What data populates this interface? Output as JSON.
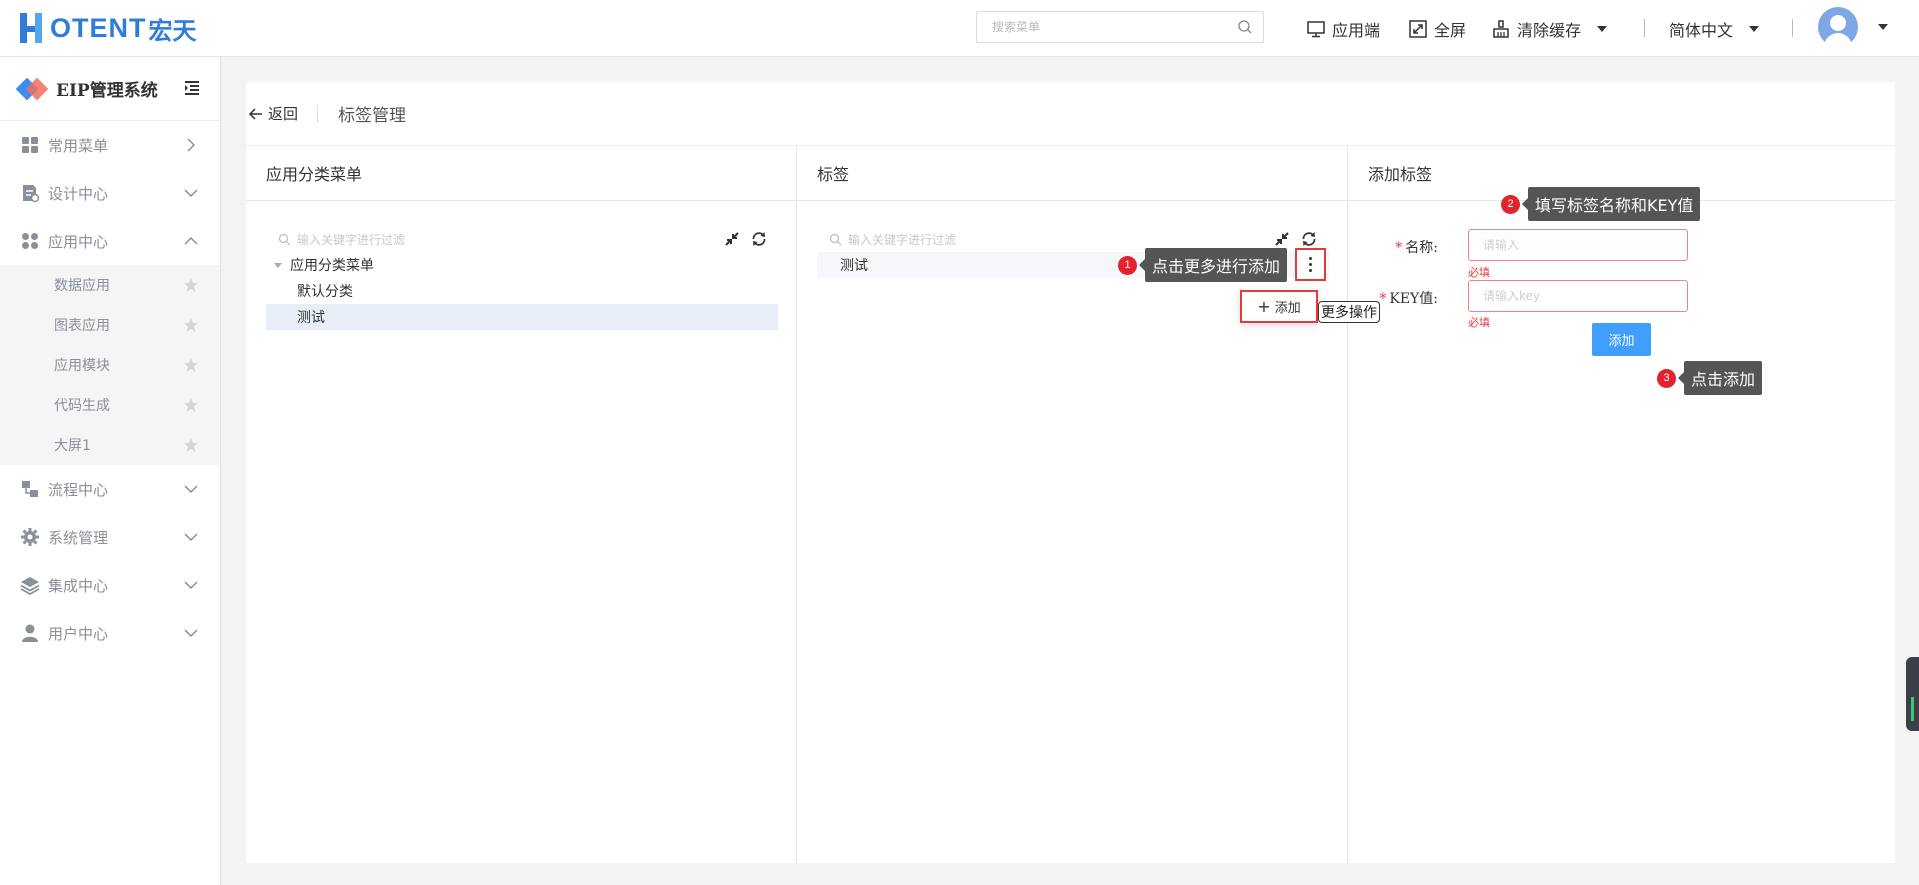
{
  "header": {
    "logo_text": "OTENT",
    "logo_cn": "宏天",
    "search_placeholder": "搜索菜单",
    "nav": {
      "app_end": "应用端",
      "fullscreen": "全屏",
      "clear_cache": "清除缓存",
      "language": "简体中文"
    }
  },
  "sidebar": {
    "system_name": "EIP管理系统",
    "menus": [
      {
        "label": "常用菜单",
        "icon": "grid-icon",
        "state": "collapsed-right"
      },
      {
        "label": "设计中心",
        "icon": "design-doc-icon",
        "state": "collapsed"
      },
      {
        "label": "应用中心",
        "icon": "apps-icon",
        "state": "expanded"
      },
      {
        "label": "流程中心",
        "icon": "flow-icon",
        "state": "collapsed"
      },
      {
        "label": "系统管理",
        "icon": "gear-icon",
        "state": "collapsed"
      },
      {
        "label": "集成中心",
        "icon": "layers-icon",
        "state": "collapsed"
      },
      {
        "label": "用户中心",
        "icon": "user-icon",
        "state": "collapsed"
      }
    ],
    "app_center_items": [
      "数据应用",
      "图表应用",
      "应用模块",
      "代码生成",
      "大屏1"
    ]
  },
  "page": {
    "back_label": "返回",
    "title": "标签管理"
  },
  "category_panel": {
    "title": "应用分类菜单",
    "filter_placeholder": "输入关键字进行过滤",
    "tree": {
      "root": "应用分类菜单",
      "children": [
        "默认分类",
        "测试"
      ],
      "selected": "测试"
    }
  },
  "tag_panel": {
    "title": "标签",
    "filter_placeholder": "输入关键字进行过滤",
    "row_label": "测试",
    "dropdown_add": "添加",
    "more_tooltip": "更多操作"
  },
  "add_panel": {
    "title": "添加标签",
    "name_label": "名称:",
    "name_placeholder": "请输入",
    "key_label": "KEY值:",
    "key_placeholder": "请输入key",
    "required_msg": "必填",
    "submit_label": "添加"
  },
  "callouts": [
    {
      "num": "1",
      "text": "点击更多进行添加"
    },
    {
      "num": "2",
      "text": "填写标签名称和KEY值"
    },
    {
      "num": "3",
      "text": "点击添加"
    }
  ],
  "colors": {
    "brand": "#2f7dd6",
    "primary_button": "#409eff",
    "error": "#e43a3a",
    "callout_badge": "#e2232b",
    "callout_bubble": "#555555"
  }
}
